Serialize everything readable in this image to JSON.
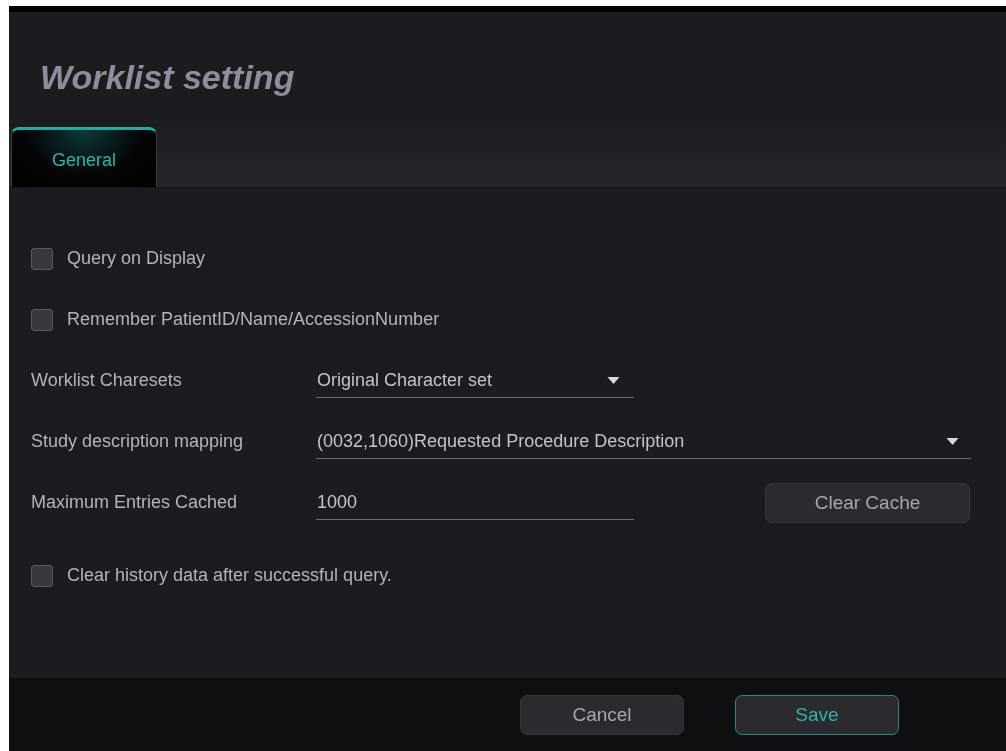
{
  "dialog": {
    "title": "Worklist setting"
  },
  "tabs": [
    {
      "label": "General",
      "selected": true
    }
  ],
  "settings": [
    {
      "kind": "checkbox",
      "label": "Query on Display",
      "checked": false
    },
    {
      "kind": "checkbox",
      "label": "Remember PatientID/Name/AccessionNumber",
      "checked": false
    },
    {
      "kind": "dropdown",
      "label": "Worklist Charesets",
      "value": "Original Character set"
    },
    {
      "kind": "wide-dropdown",
      "label": "Study description mapping",
      "value": "(0032,1060)Requested Procedure Description"
    },
    {
      "kind": "field",
      "label": "Maximum Entries Cached",
      "value": "1000",
      "button": "Clear Cache"
    },
    {
      "kind": "checkbox",
      "label": "Clear history data after successful query.",
      "checked": false
    }
  ],
  "buttons": [
    {
      "label": "Cancel",
      "kind": "secondary"
    },
    {
      "label": "Save",
      "kind": "primary"
    }
  ]
}
